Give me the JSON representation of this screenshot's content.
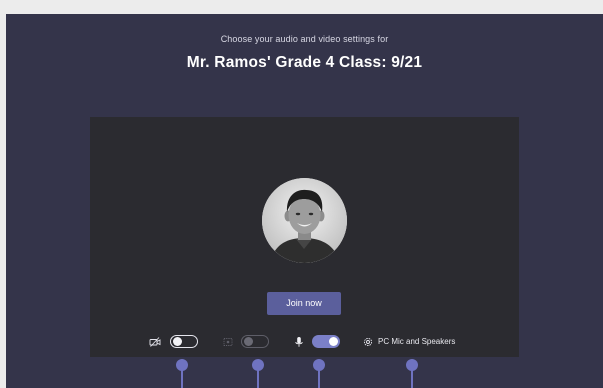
{
  "header": {
    "subtitle": "Choose your audio and video settings for",
    "meeting_title": "Mr. Ramos' Grade 4 Class: 9/21"
  },
  "preview": {
    "join_label": "Join now"
  },
  "controls": {
    "camera": {
      "icon": "camera-off-icon",
      "state": "off"
    },
    "background_effects": {
      "icon": "background-blur-icon",
      "state": "disabled"
    },
    "microphone": {
      "icon": "microphone-icon",
      "state": "on"
    },
    "device_settings": {
      "icon": "gear-icon",
      "label": "PC Mic and Speakers"
    }
  },
  "colors": {
    "stage_background": "#34344a",
    "preview_background": "#2b2b30",
    "accent": "#5b5f9c",
    "toggle_on": "#7b80c8",
    "callout": "#6f73c0"
  }
}
